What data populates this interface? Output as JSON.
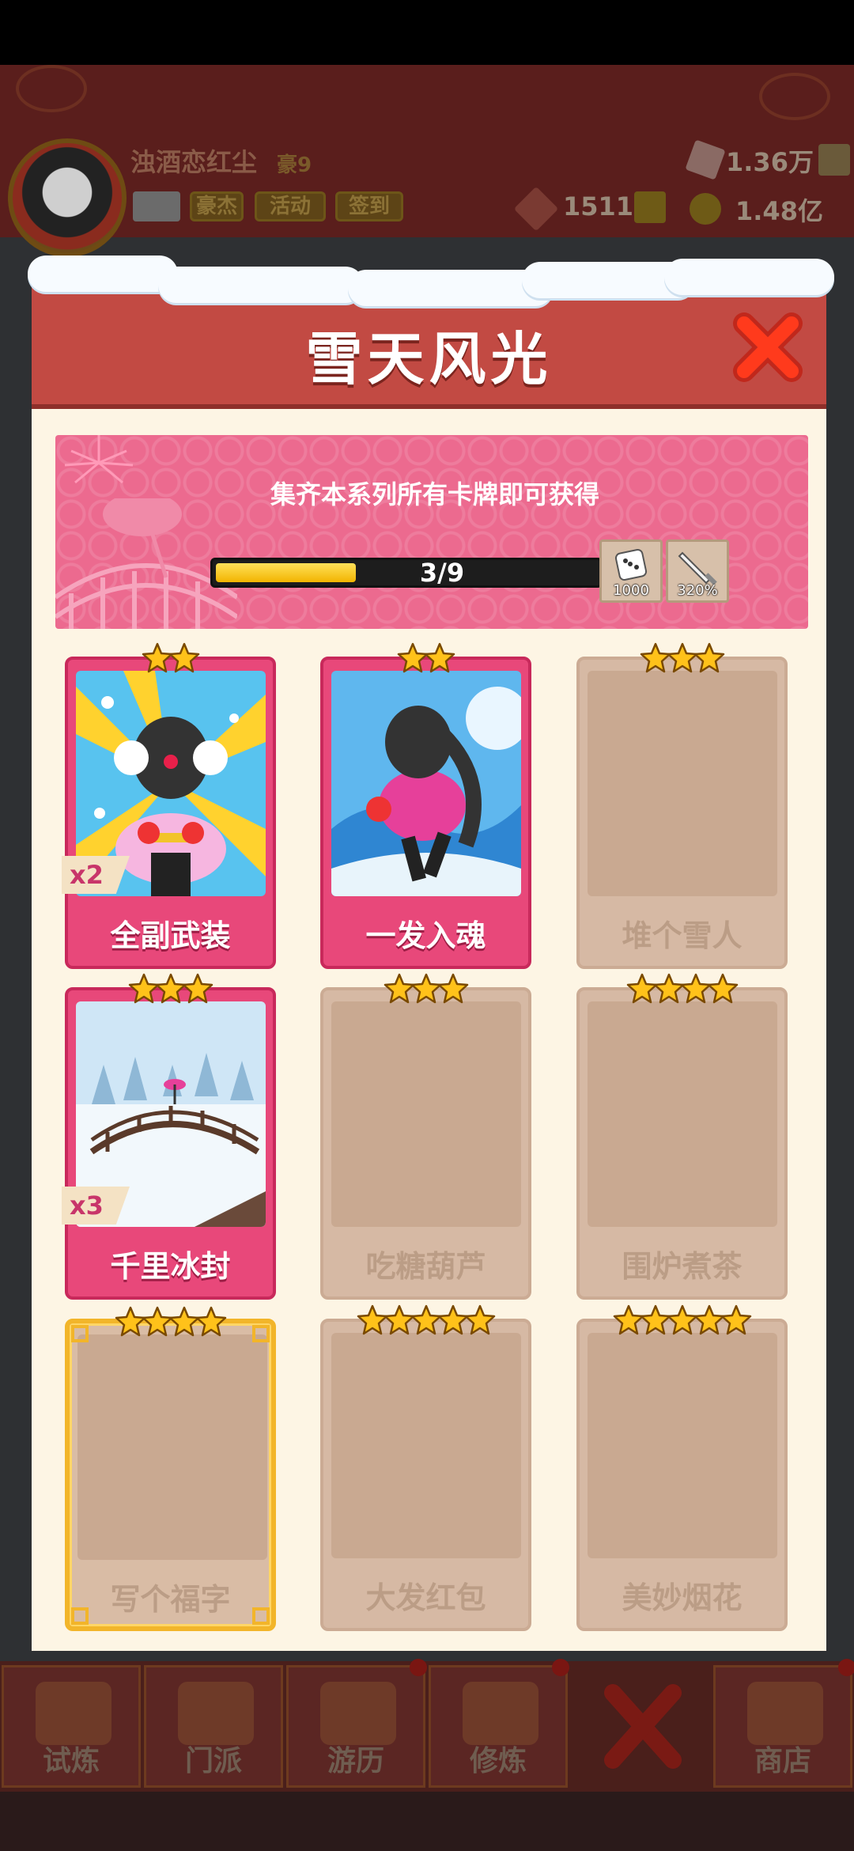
{
  "player": {
    "name": "浊酒恋红尘",
    "title": "豪9",
    "buttons": [
      "豪杰",
      "活动",
      "签到"
    ],
    "resources": {
      "gems": "1.36万",
      "ticket": "1511",
      "gold": "1.48亿"
    }
  },
  "modal": {
    "title": "雪天风光",
    "banner_text": "集齐本系列所有卡牌即可获得",
    "progress": {
      "text": "3/9",
      "fraction": 0.333
    },
    "rewards": [
      {
        "icon": "dice-icon",
        "value": "1000"
      },
      {
        "icon": "sword-icon",
        "value": "320%"
      }
    ]
  },
  "cards": [
    {
      "name": "全副武装",
      "stars": 2,
      "owned": true,
      "count": "x2",
      "art": "girl-earmuffs"
    },
    {
      "name": "一发入魂",
      "stars": 2,
      "owned": true,
      "count": "",
      "art": "girl-snowball"
    },
    {
      "name": "堆个雪人",
      "stars": 3,
      "owned": false,
      "count": ""
    },
    {
      "name": "千里冰封",
      "stars": 3,
      "owned": true,
      "count": "x3",
      "art": "snow-bridge"
    },
    {
      "name": "吃糖葫芦",
      "stars": 3,
      "owned": false,
      "count": ""
    },
    {
      "name": "围炉煮茶",
      "stars": 4,
      "owned": false,
      "count": ""
    },
    {
      "name": "写个福字",
      "stars": 4,
      "owned": false,
      "count": "",
      "gold_frame": true
    },
    {
      "name": "大发红包",
      "stars": 5,
      "owned": false,
      "count": ""
    },
    {
      "name": "美妙烟花",
      "stars": 5,
      "owned": false,
      "count": ""
    }
  ],
  "bottom_nav": [
    {
      "label": "试炼",
      "icon": "trial-icon"
    },
    {
      "label": "门派",
      "icon": "sect-icon"
    },
    {
      "label": "游历",
      "icon": "travel-icon"
    },
    {
      "label": "修炼",
      "icon": "cultivate-icon"
    },
    {
      "label": "",
      "icon": "close-icon"
    },
    {
      "label": "商店",
      "icon": "shop-icon"
    }
  ],
  "colors": {
    "owned_card": "#e8487a",
    "locked_card": "#d6b9a4",
    "header": "#c24a43",
    "star": "#ffc21a"
  }
}
